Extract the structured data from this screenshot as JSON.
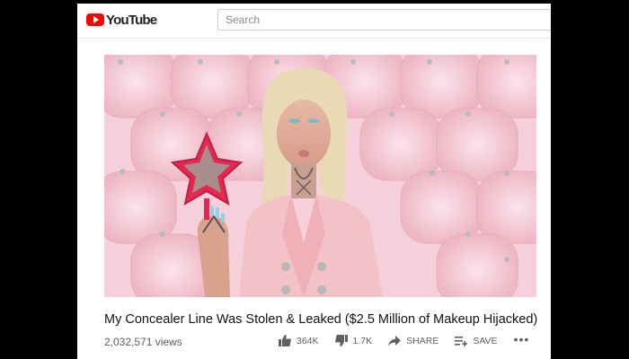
{
  "header": {
    "logo_text": "YouTube",
    "search_placeholder": "Search"
  },
  "video": {
    "title": "My Concealer Line Was Stolen & Leaked ($2.5 Million of Makeup Hijacked)",
    "views": "2,032,571 views",
    "likes": "364K",
    "dislikes": "1.7K",
    "share_label": "SHARE",
    "save_label": "SAVE",
    "more_label": "•••"
  },
  "icons": [
    "youtube-logo-icon",
    "thumbs-up-icon",
    "thumbs-down-icon",
    "share-icon",
    "save-playlist-icon",
    "more-icon"
  ],
  "colors": {
    "brand_red": "#ff0000",
    "backdrop_pink": "#f3c9d6",
    "blazer_pink": "#f2c3c8"
  }
}
